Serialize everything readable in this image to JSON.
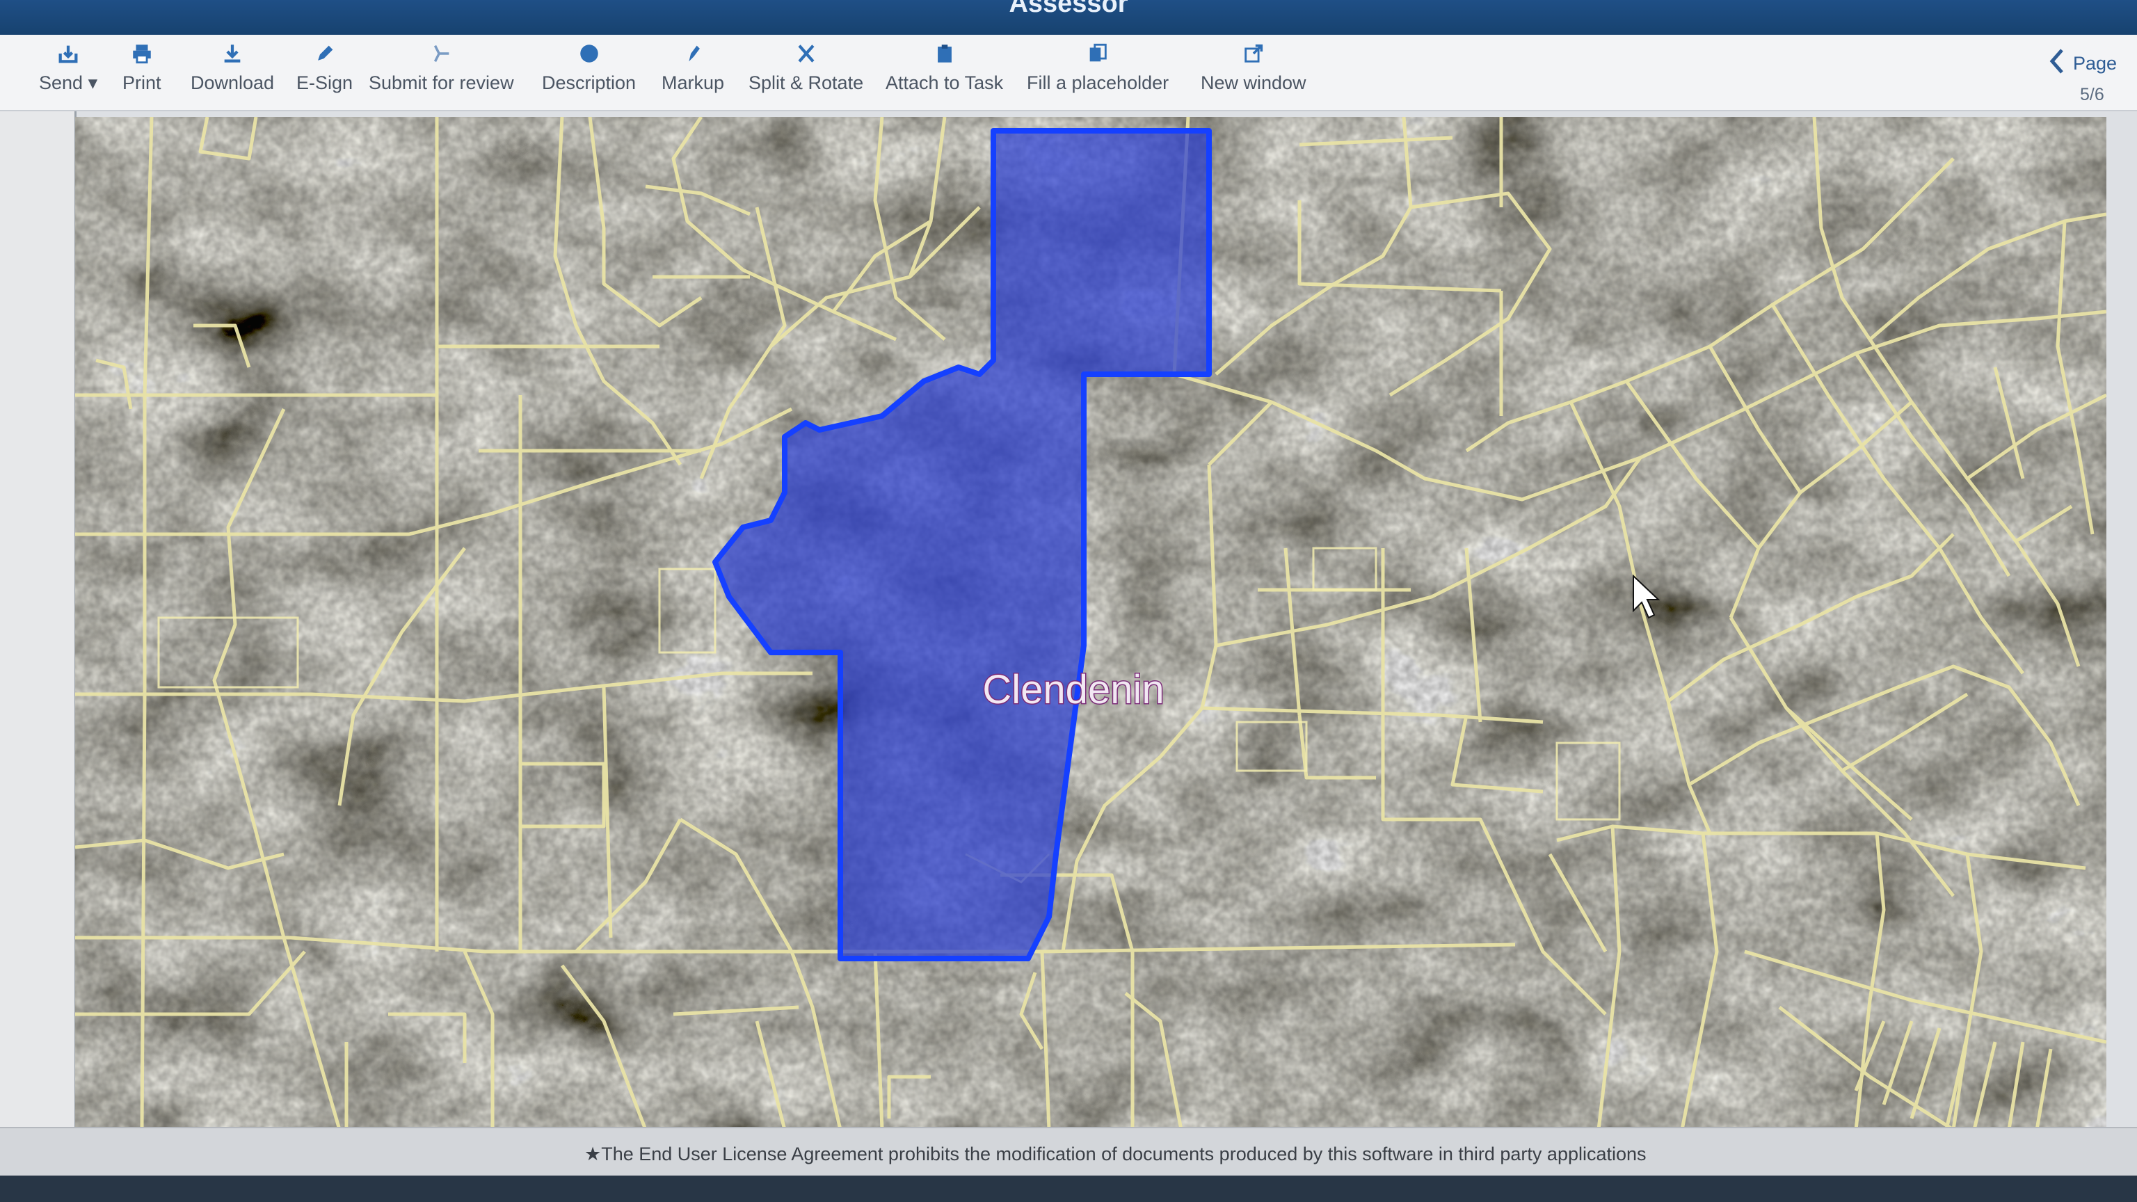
{
  "window": {
    "title": "Assessor"
  },
  "toolbar": {
    "send": "Send",
    "print": "Print",
    "download": "Download",
    "esign": "E-Sign",
    "submit_review": "Submit for review",
    "description": "Description",
    "markup": "Markup",
    "split_rotate": "Split & Rotate",
    "attach_task": "Attach to Task",
    "fill_placeholder": "Fill a placeholder",
    "new_window": "New window"
  },
  "pager": {
    "label": "Page",
    "count": "5/6"
  },
  "map": {
    "town_label": "Clendenin",
    "highlight_color": "#2b3fd0",
    "parcel_line_color": "#e9e3a6"
  },
  "footer": {
    "notice": "★The End User License Agreement prohibits the modification of documents produced by this software in third party applications"
  }
}
